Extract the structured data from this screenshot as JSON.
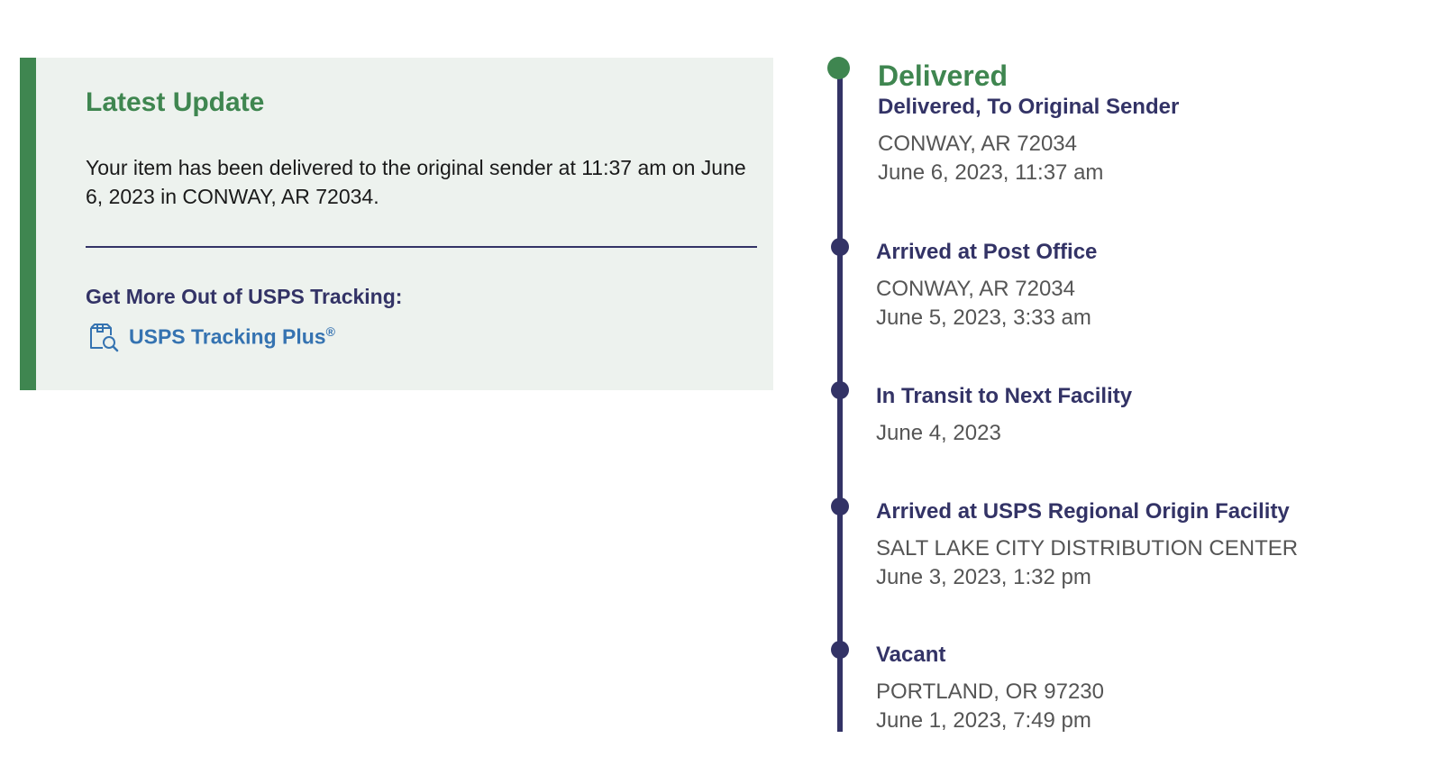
{
  "latest_update": {
    "title": "Latest Update",
    "body": "Your item has been delivered to the original sender at 11:37 am on June 6, 2023 in CONWAY, AR 72034.",
    "more_heading": "Get More Out of USPS Tracking:",
    "plus_link_label": "USPS Tracking Plus",
    "plus_link_mark": "®",
    "icon": "package-search-icon"
  },
  "tracking": {
    "current_status": "Delivered",
    "events": [
      {
        "status": "Delivered, To Original Sender",
        "location": "CONWAY, AR 72034",
        "datetime": "June 6, 2023, 11:37 am"
      },
      {
        "status": "Arrived at Post Office",
        "location": "CONWAY, AR 72034",
        "datetime": "June 5, 2023, 3:33 am"
      },
      {
        "status": "In Transit to Next Facility",
        "location": "",
        "datetime": "June 4, 2023"
      },
      {
        "status": "Arrived at USPS Regional Origin Facility",
        "location": "SALT LAKE CITY DISTRIBUTION CENTER",
        "datetime": "June 3, 2023, 1:32 pm"
      },
      {
        "status": "Vacant",
        "location": "PORTLAND, OR 97230",
        "datetime": "June 1, 2023, 7:49 pm"
      }
    ]
  },
  "colors": {
    "accent_green": "#3f8650",
    "navy": "#333366",
    "link_blue": "#3573b1",
    "card_background": "#edf2ee"
  }
}
